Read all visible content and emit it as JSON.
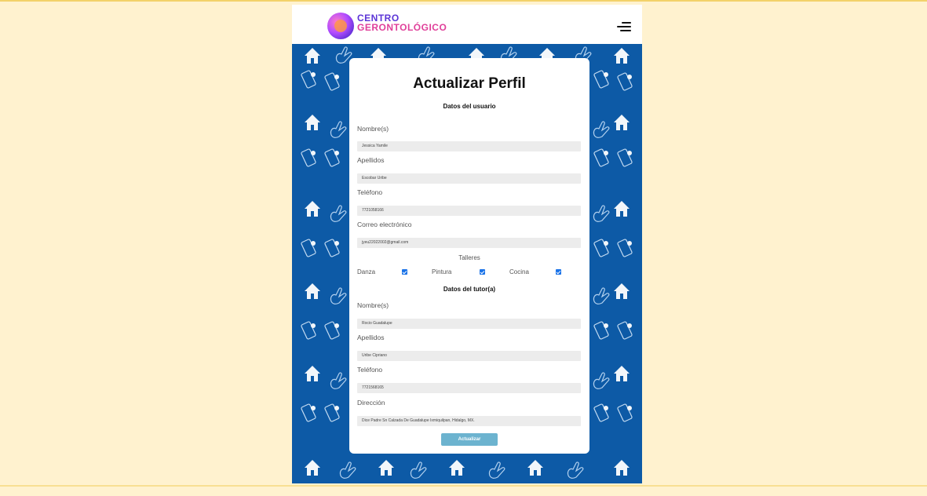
{
  "header": {
    "logo_line1": "CENTRO",
    "logo_line2": "GERONTOLÓGICO",
    "menu_icon": "hamburger-menu-icon"
  },
  "form": {
    "title": "Actualizar Perfil",
    "user_section_title": "Datos del usuario",
    "user_fields": [
      {
        "label": "Nombre(s)",
        "value": "Jessica Yamile"
      },
      {
        "label": "Apellidos",
        "value": "Escobar Uribe"
      },
      {
        "label": "Teléfono",
        "value": "7721058166"
      },
      {
        "label": "Correo electrónico",
        "value": "jyeu22022002@gmail.com"
      }
    ],
    "talleres_label": "Talleres",
    "talleres": [
      {
        "label": "Danza",
        "checked": true
      },
      {
        "label": "Pintura",
        "checked": true
      },
      {
        "label": "Cocina",
        "checked": true
      }
    ],
    "tutor_section_title": "Datos del tutor(a)",
    "tutor_fields": [
      {
        "label": "Nombre(s)",
        "value": "Rocio Guadalupe"
      },
      {
        "label": "Apellidos",
        "value": "Uribe Cipriano"
      },
      {
        "label": "Teléfono",
        "value": "7721568165"
      },
      {
        "label": "Dirección",
        "value": "Dice Padre Sn Calzada De Guadalupe Ixmiquilpan, Hidalgo, MX."
      }
    ],
    "submit_label": "Actualizar"
  },
  "colors": {
    "page_bg": "#fff2cf",
    "pattern_bg": "#0d5aa6",
    "button_bg": "#6cb3cf",
    "checkbox": "#1b73e8"
  }
}
